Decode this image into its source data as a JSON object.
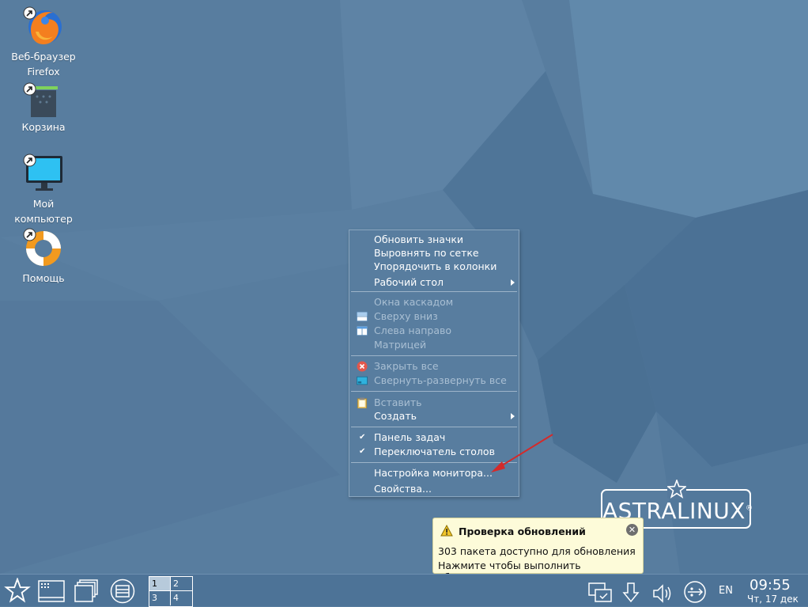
{
  "desktop_icons": [
    {
      "line1": "Веб-браузер",
      "line2": "Firefox",
      "icon": "firefox-icon"
    },
    {
      "line1": "Корзина",
      "line2": "",
      "icon": "trash-icon"
    },
    {
      "line1": "Мой",
      "line2": "компьютер",
      "icon": "monitor-icon"
    },
    {
      "line1": "Помощь",
      "line2": "",
      "icon": "lifebuoy-icon"
    }
  ],
  "context_menu": {
    "items": [
      {
        "label": "Обновить значки",
        "enabled": true
      },
      {
        "label": "Выровнять по сетке",
        "enabled": true
      },
      {
        "label": "Упорядочить в колонки",
        "enabled": true
      },
      {
        "label": "Рабочий стол",
        "enabled": true,
        "submenu": true
      },
      {
        "label": "Окна каскадом",
        "enabled": false
      },
      {
        "label": "Сверху вниз",
        "enabled": false,
        "icon": "tile-horizontal-icon"
      },
      {
        "label": "Слева направо",
        "enabled": false,
        "icon": "tile-vertical-icon"
      },
      {
        "label": "Матрицей",
        "enabled": false
      },
      {
        "label": "Закрыть все",
        "enabled": false,
        "icon": "close-all-icon"
      },
      {
        "label": "Свернуть-развернуть все",
        "enabled": false,
        "icon": "minimize-all-icon"
      },
      {
        "label": "Вставить",
        "enabled": false,
        "icon": "paste-icon"
      },
      {
        "label": "Создать",
        "enabled": true,
        "submenu": true
      },
      {
        "label": "Панель задач",
        "enabled": true,
        "checked": true
      },
      {
        "label": "Переключатель столов",
        "enabled": true,
        "checked": true
      },
      {
        "label": "Настройка монитора...",
        "enabled": true
      },
      {
        "label": "Свойства...",
        "enabled": true
      }
    ]
  },
  "notification": {
    "title": "Проверка обновлений",
    "line1": "303 пакета доступно для обновления",
    "line2": "Нажмите чтобы выполнить обновление",
    "close_icon": "close-icon",
    "warning_icon": "warning-icon"
  },
  "logo": {
    "text": "ASTRALINUX",
    "mark": "®"
  },
  "taskbar": {
    "pager": [
      "1",
      "2",
      "3",
      "4"
    ],
    "active_desktop": "1",
    "language": "EN",
    "time": "09:55",
    "date": "Чт, 17 дек"
  },
  "colors": {
    "desktop": "#587d9f",
    "taskbar": "#4d7397",
    "notification_bg": "#fdfbd9",
    "arrow": "#d42a2a"
  }
}
